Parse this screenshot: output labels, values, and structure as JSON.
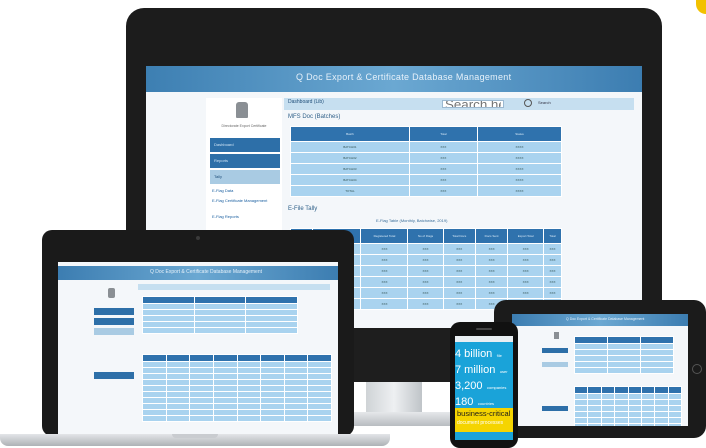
{
  "monitor_app": {
    "banner_title": "Q Doc Export & Certificate Database Management",
    "toolbar_title": "Dashboard (Lib)",
    "search_placeholder": "Search here",
    "search_button": "Search",
    "section1_title": "MFS Doc (Batches)",
    "section2_title": "E-File Tally",
    "caption": "E-Flag Table (Monthly, Batchwise, 2019)",
    "org_name": "Directorate Export Certificate",
    "nav_items": [
      "Dashboard",
      "Reports",
      "Tally",
      "E-Flag Data",
      "E-Flag Certificate Management",
      "E-Flag Reports"
    ],
    "table1_headers": [
      "Batch",
      "Total",
      "Status"
    ],
    "table1_rows": [
      [
        "BATCH01",
        "XXX",
        "XXXX"
      ],
      [
        "BATCH02",
        "XXX",
        "XXXX"
      ],
      [
        "BATCH03",
        "XXX",
        "XXXX"
      ],
      [
        "BATCH04",
        "XXX",
        "XXXX"
      ],
      [
        "TOTAL",
        "XXX",
        "XXXX"
      ]
    ],
    "table2_headers": [
      "Month",
      "Document Count",
      "Registered Total",
      "No of Flags",
      "Total Docs",
      "Docs Sent",
      "Export Total",
      "Total"
    ],
    "table2_rows": [
      [
        "",
        "",
        "XXX",
        "XXX",
        "XXX",
        "XXX",
        "XXX",
        "XXX"
      ],
      [
        "",
        "",
        "XXX",
        "XXX",
        "XXX",
        "XXX",
        "XXX",
        "XXX"
      ],
      [
        "",
        "",
        "XXX",
        "XXX",
        "XXX",
        "XXX",
        "XXX",
        "XXX"
      ],
      [
        "",
        "",
        "XXX",
        "XXX",
        "XXX",
        "XXX",
        "XXX",
        "XXX"
      ],
      [
        "",
        "",
        "XXX",
        "XXX",
        "XXX",
        "XXX",
        "XXX",
        "XXX"
      ],
      [
        "",
        "",
        "XXX",
        "XXX",
        "XXX",
        "XXX",
        "XXX",
        "XXX"
      ]
    ]
  },
  "laptop_app": {
    "banner_title": "Q Doc Export & Certificate Database Management"
  },
  "tablet_app": {
    "banner_title": "Q Doc Export & Certificate Database Management"
  },
  "phone_app": {
    "stats": [
      {
        "value": "4 billion",
        "label": "file"
      },
      {
        "value": "7 million",
        "label": "user"
      },
      {
        "value": "3,200",
        "label": "companies"
      },
      {
        "value": "180",
        "label": "countries"
      }
    ],
    "highlight_title": "business-critical",
    "highlight_subtitle": "document processes"
  },
  "colors": {
    "banner": "#3d7fb2",
    "nav": "#2d6fa8",
    "table_header": "#2f72ad",
    "table_cell": "#a9d3ef",
    "phone_bg": "#1aa3d9",
    "phone_highlight": "#f5d400"
  }
}
